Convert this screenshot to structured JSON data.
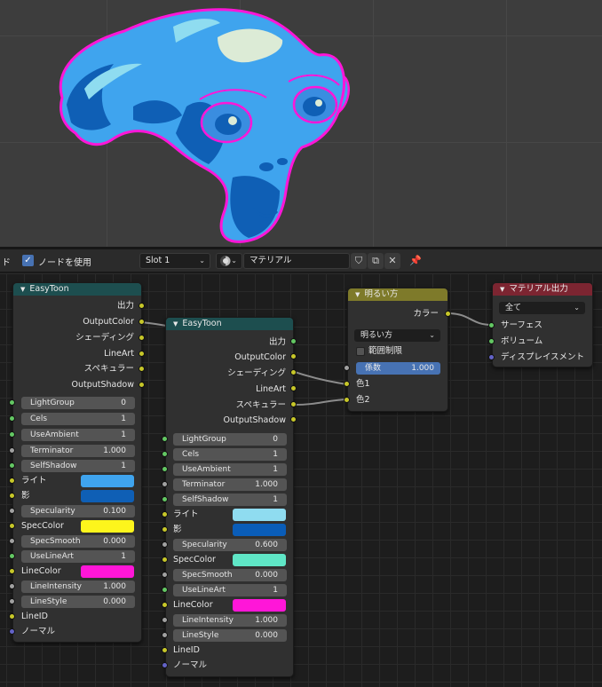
{
  "header": {
    "left_fragment": "ド",
    "use_nodes_label": "ノードを使用",
    "use_nodes_checked": true,
    "slot_value": "Slot 1",
    "material_name": "マテリアル"
  },
  "node1": {
    "title": "EasyToon",
    "outputs": [
      "出力",
      "OutputColor",
      "シェーディング",
      "LineArt",
      "スペキュラー",
      "OutputShadow"
    ],
    "fields": [
      {
        "label": "LightGroup",
        "value": "0"
      },
      {
        "label": "Cels",
        "value": "1"
      },
      {
        "label": "UseAmbient",
        "value": "1"
      },
      {
        "label": "Terminator",
        "value": "1.000"
      },
      {
        "label": "SelfShadow",
        "value": "1"
      }
    ],
    "light_label": "ライト",
    "light_color": "#3fa4ee",
    "shadow_label": "影",
    "shadow_color": "#0f5fb5",
    "specularity": {
      "label": "Specularity",
      "value": "0.100"
    },
    "speccolor_label": "SpecColor",
    "speccolor_color": "#fdf51c",
    "specsmooth": {
      "label": "SpecSmooth",
      "value": "0.000"
    },
    "uselineart": {
      "label": "UseLineArt",
      "value": "1"
    },
    "linecolor_label": "LineColor",
    "linecolor_color": "#ff16d8",
    "lineintensity": {
      "label": "LineIntensity",
      "value": "1.000"
    },
    "linestyle": {
      "label": "LineStyle",
      "value": "0.000"
    },
    "lineid_label": "LineID",
    "normal_label": "ノーマル"
  },
  "node2": {
    "title": "EasyToon",
    "outputs": [
      "出力",
      "OutputColor",
      "シェーディング",
      "LineArt",
      "スペキュラー",
      "OutputShadow"
    ],
    "fields": [
      {
        "label": "LightGroup",
        "value": "0"
      },
      {
        "label": "Cels",
        "value": "1"
      },
      {
        "label": "UseAmbient",
        "value": "1"
      },
      {
        "label": "Terminator",
        "value": "1.000"
      },
      {
        "label": "SelfShadow",
        "value": "1"
      }
    ],
    "light_label": "ライト",
    "light_color": "#8fdcf0",
    "shadow_label": "影",
    "shadow_color": "#0a5db8",
    "specularity": {
      "label": "Specularity",
      "value": "0.600"
    },
    "speccolor_label": "SpecColor",
    "speccolor_color": "#5fe6c6",
    "specsmooth": {
      "label": "SpecSmooth",
      "value": "0.000"
    },
    "uselineart": {
      "label": "UseLineArt",
      "value": "1"
    },
    "linecolor_label": "LineColor",
    "linecolor_color": "#ff16d8",
    "lineintensity": {
      "label": "LineIntensity",
      "value": "1.000"
    },
    "linestyle": {
      "label": "LineStyle",
      "value": "0.000"
    },
    "lineid_label": "LineID",
    "normal_label": "ノーマル"
  },
  "lighten": {
    "title": "明るい方",
    "output": "カラー",
    "mode": "明るい方",
    "clamp_label": "範囲制限",
    "clamp_checked": false,
    "factor_label": "係数",
    "factor_value": "1.000",
    "color1": "色1",
    "color2": "色2"
  },
  "output": {
    "title": "マテリアル出力",
    "target": "全て",
    "inputs": [
      "サーフェス",
      "ボリューム",
      "ディスプレイスメント"
    ]
  },
  "colors": {
    "easytoon_header": "#1d4e4f",
    "lighten_header": "#7e7a2a",
    "output_header": "#7c2531",
    "accent_blue": "#4772b3"
  }
}
